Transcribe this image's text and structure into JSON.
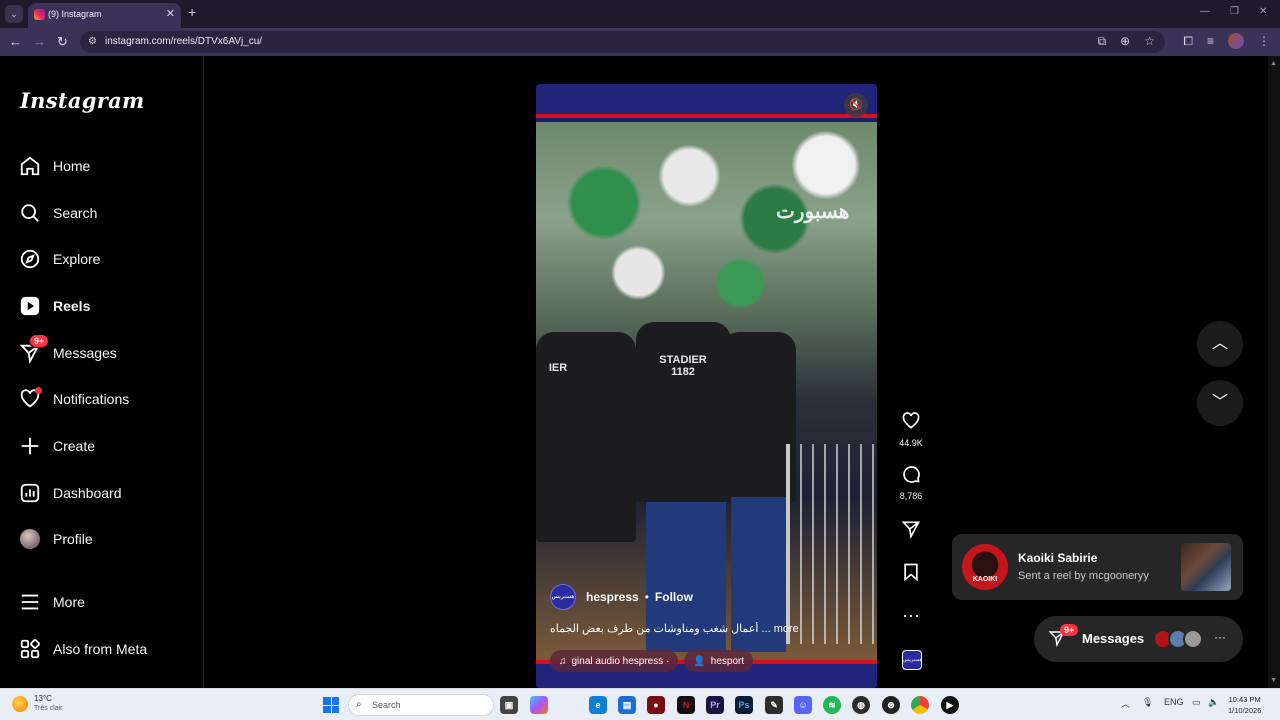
{
  "browser": {
    "tab_title": "(9) Instagram",
    "url": "instagram.com/reels/DTVx6AVj_cu/"
  },
  "sidebar": {
    "logo": "Instagram",
    "items": [
      {
        "label": "Home"
      },
      {
        "label": "Search"
      },
      {
        "label": "Explore"
      },
      {
        "label": "Reels"
      },
      {
        "label": "Messages",
        "badge": "9+"
      },
      {
        "label": "Notifications"
      },
      {
        "label": "Create"
      },
      {
        "label": "Dashboard"
      },
      {
        "label": "Profile"
      },
      {
        "label": "More"
      },
      {
        "label": "Also from Meta"
      }
    ]
  },
  "reel": {
    "author": "hespress",
    "separator": "•",
    "follow": "Follow",
    "caption": "أعمال شغب ومناوشات من طرف بعض الجماه ... more",
    "jacket_text": "STADIER\n1182",
    "jacket_text_left": "IER",
    "watermark": "هسبورت",
    "author_logo": "هسبريس",
    "audio": "ginal audio  hespress ·",
    "tag": "hesport",
    "likes": "44.9K",
    "comments": "8,786"
  },
  "notification": {
    "name": "Kaoiki Sabirie",
    "text": "Sent a reel by mcgooneryy",
    "avatar_text": "KAOIKI"
  },
  "messages_pill": {
    "label": "Messages",
    "badge": "9+"
  },
  "taskbar": {
    "temp": "13°C",
    "weather": "Très clair",
    "search_placeholder": "Search",
    "lang": "ENG",
    "time": "10:43 PM",
    "date": "1/10/2026"
  },
  "colors": {
    "accent_red": "#ff3040",
    "reel_band": "#22247a"
  }
}
